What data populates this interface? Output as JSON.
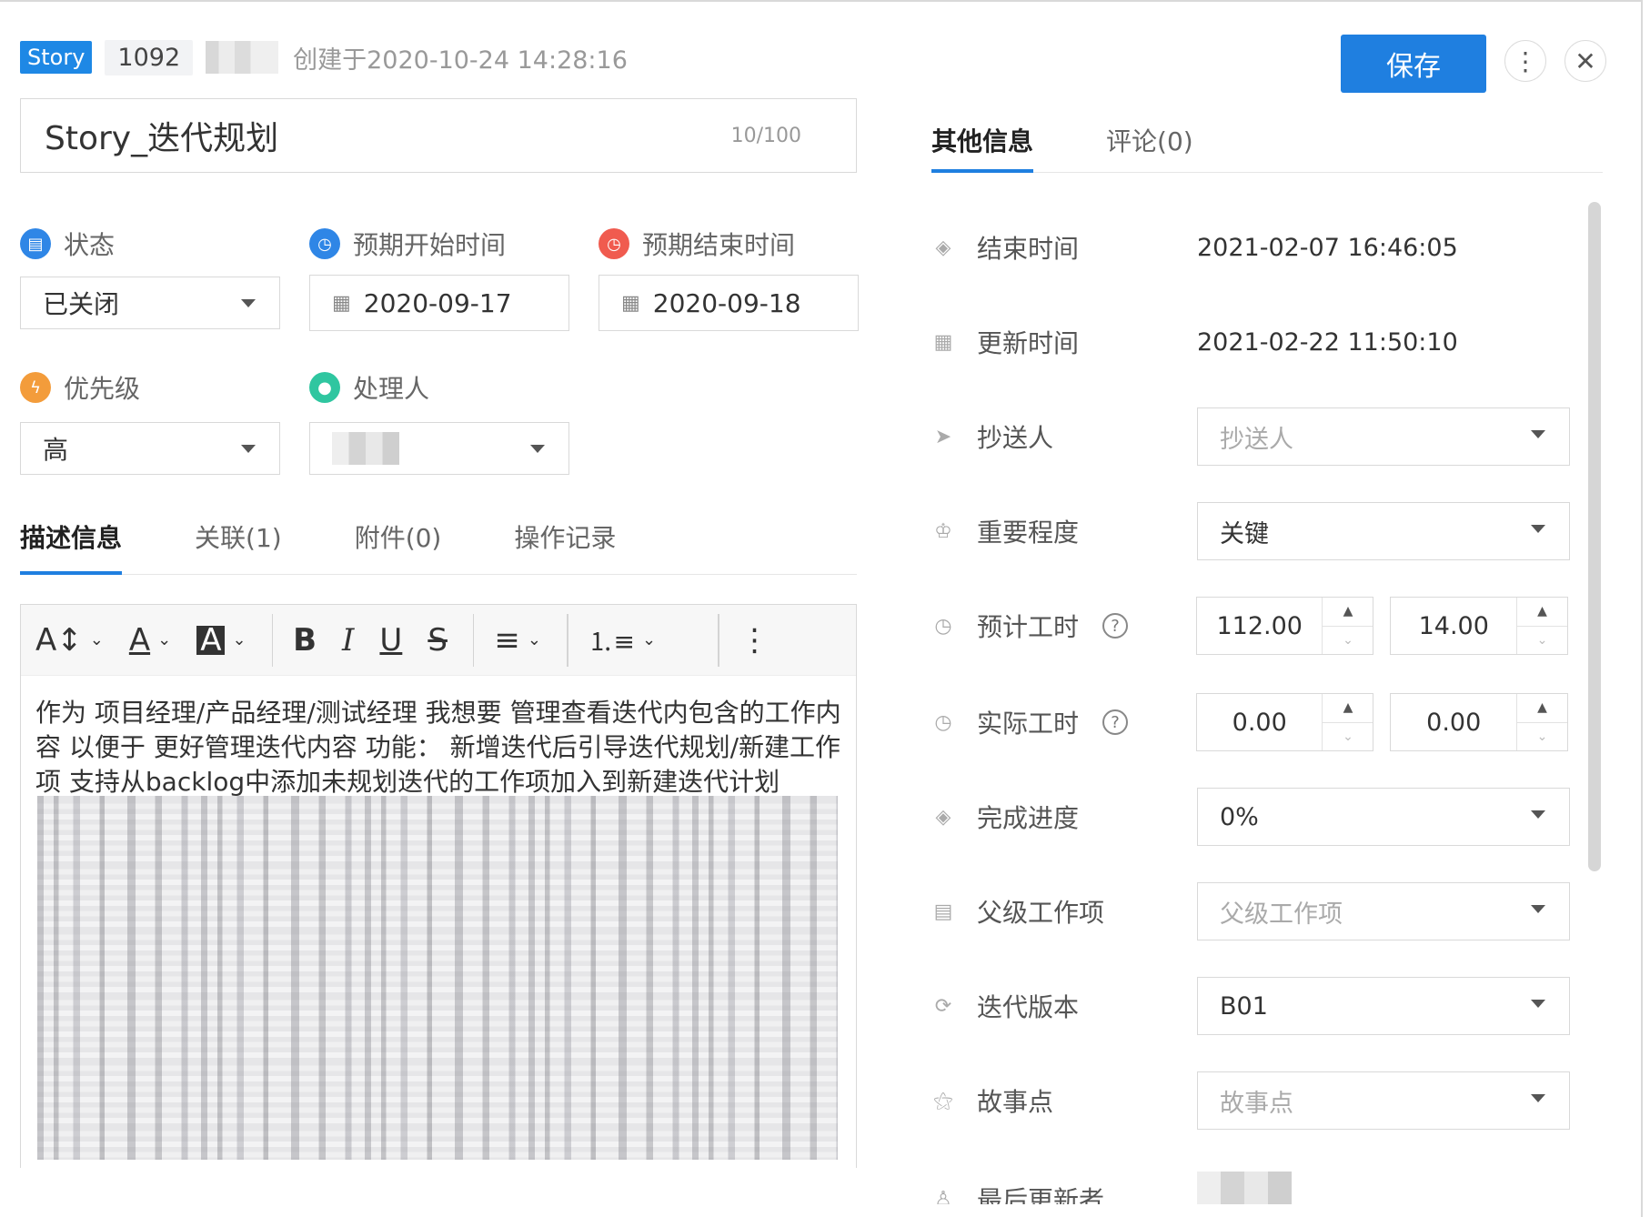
{
  "header": {
    "type_badge": "Story",
    "item_id": "1092",
    "created": "创建于2020-10-24 14:28:16",
    "save_label": "保存",
    "more_icon": "more-vertical-icon",
    "close_icon": "close-icon"
  },
  "title": {
    "value": "Story_迭代规划",
    "counter": "10/100"
  },
  "fields": {
    "status": {
      "label": "状态",
      "value": "已关闭"
    },
    "start": {
      "label": "预期开始时间",
      "value": "2020-09-17"
    },
    "end": {
      "label": "预期结束时间",
      "value": "2020-09-18"
    },
    "priority": {
      "label": "优先级",
      "value": "高"
    },
    "assignee": {
      "label": "处理人"
    }
  },
  "tabs": [
    "描述信息",
    "关联(1)",
    "附件(0)",
    "操作记录"
  ],
  "editor": {
    "description": "作为  项目经理/产品经理/测试经理 我想要  管理查看迭代内包含的工作内容 以便于 更好管理迭代内容 功能：  新增迭代后引导迭代规划/新建工作项 支持从backlog中添加未规划迭代的工作项加入到新建迭代计划"
  },
  "right_tabs": [
    "其他信息",
    "评论(0)"
  ],
  "right": {
    "end_time": {
      "label": "结束时间",
      "value": "2021-02-07 16:46:05"
    },
    "update_time": {
      "label": "更新时间",
      "value": "2021-02-22 11:50:10"
    },
    "cc": {
      "label": "抄送人",
      "placeholder": "抄送人"
    },
    "importance": {
      "label": "重要程度",
      "value": "关键"
    },
    "estimate": {
      "label": "预计工时",
      "v1": "112.00",
      "v2": "14.00"
    },
    "actual": {
      "label": "实际工时",
      "v1": "0.00",
      "v2": "0.00"
    },
    "progress": {
      "label": "完成进度",
      "value": "0%"
    },
    "parent": {
      "label": "父级工作项",
      "placeholder": "父级工作项"
    },
    "iteration": {
      "label": "迭代版本",
      "value": "B01"
    },
    "story_points": {
      "label": "故事点",
      "placeholder": "故事点"
    },
    "last_updater": {
      "label": "最后更新者"
    }
  },
  "colors": {
    "accent": "#1f7fe0",
    "status_icon": "#2f86e6",
    "start_icon": "#2f86e6",
    "end_icon": "#f05b4f",
    "priority_icon": "#f39c3b",
    "assignee_icon": "#2fc6a0"
  }
}
